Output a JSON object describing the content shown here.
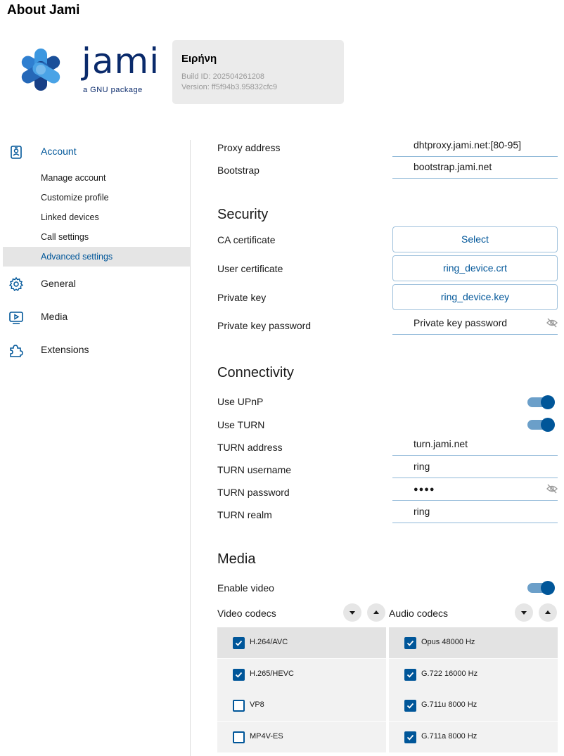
{
  "window_title": "About Jami",
  "logo": {
    "word": "jami",
    "tagline": "a GNU package"
  },
  "version": {
    "name": "Ειρήνη",
    "build": "Build ID: 202504261208",
    "version": "Version: ff5f94b3.95832cfc9"
  },
  "sidebar": {
    "items": [
      {
        "label": "Account",
        "icon": "account-icon",
        "active": true
      },
      {
        "label": "General",
        "icon": "gear-icon"
      },
      {
        "label": "Media",
        "icon": "media-icon"
      },
      {
        "label": "Extensions",
        "icon": "puzzle-icon"
      }
    ],
    "subitems": [
      {
        "label": "Manage account"
      },
      {
        "label": "Customize profile"
      },
      {
        "label": "Linked devices"
      },
      {
        "label": "Call settings"
      },
      {
        "label": "Advanced settings",
        "selected": true
      }
    ]
  },
  "network": {
    "proxy_label": "Proxy address",
    "proxy_value": "dhtproxy.jami.net:[80-95]",
    "bootstrap_label": "Bootstrap",
    "bootstrap_value": "bootstrap.jami.net"
  },
  "security": {
    "title": "Security",
    "ca_label": "CA certificate",
    "ca_button": "Select",
    "user_cert_label": "User certificate",
    "user_cert_button": "ring_device.crt",
    "private_key_label": "Private key",
    "private_key_button": "ring_device.key",
    "pk_password_label": "Private key password",
    "pk_password_placeholder": "Private key password"
  },
  "connectivity": {
    "title": "Connectivity",
    "upnp_label": "Use UPnP",
    "upnp_on": true,
    "turn_label": "Use TURN",
    "turn_on": true,
    "turn_address_label": "TURN address",
    "turn_address_value": "turn.jami.net",
    "turn_username_label": "TURN username",
    "turn_username_value": "ring",
    "turn_password_label": "TURN password",
    "turn_password_value": "●●●●",
    "turn_realm_label": "TURN realm",
    "turn_realm_value": "ring"
  },
  "media": {
    "title": "Media",
    "enable_video_label": "Enable video",
    "enable_video_on": true,
    "video_codecs_label": "Video codecs",
    "audio_codecs_label": "Audio codecs",
    "video_codecs": [
      {
        "name": "H.264/AVC",
        "checked": true
      },
      {
        "name": "H.265/HEVC",
        "checked": true
      },
      {
        "name": "VP8",
        "checked": false
      },
      {
        "name": "MP4V-ES",
        "checked": false
      }
    ],
    "audio_codecs": [
      {
        "name": "Opus 48000 Hz",
        "checked": true
      },
      {
        "name": "G.722 16000 Hz",
        "checked": true
      },
      {
        "name": "G.711u 8000 Hz",
        "checked": true
      },
      {
        "name": "G.711a 8000 Hz",
        "checked": true
      }
    ]
  },
  "colors": {
    "accent": "#005699",
    "toggle_track": "#6b9fc9",
    "selected_bg": "#e5e5e5"
  }
}
